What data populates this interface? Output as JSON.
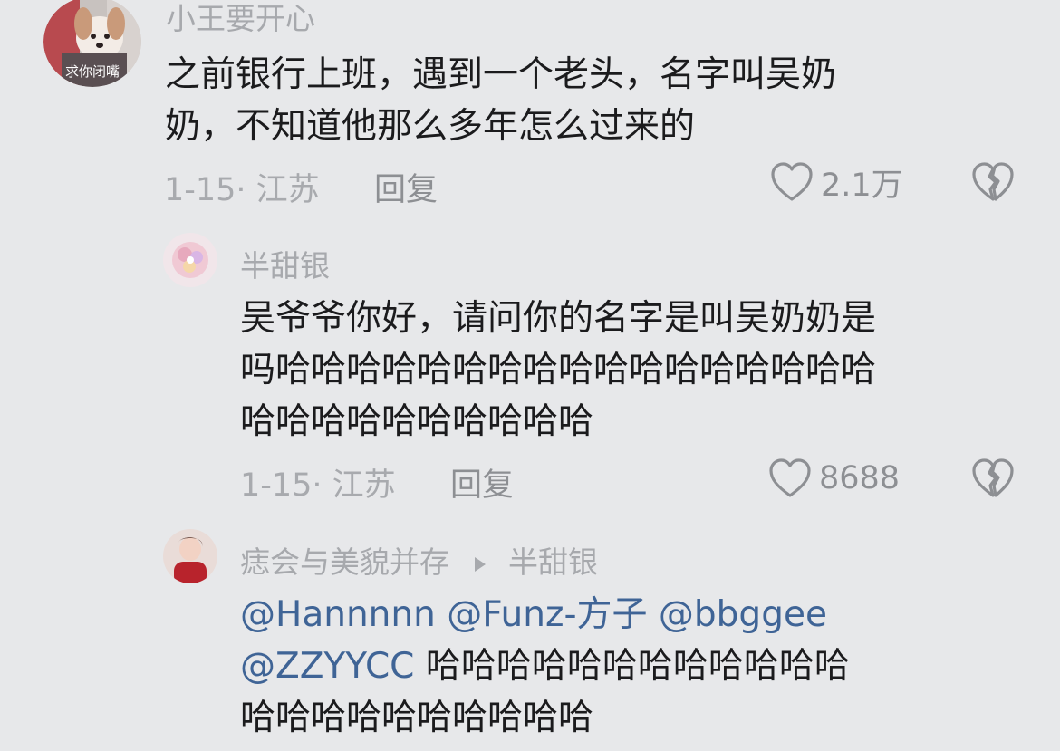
{
  "comments": [
    {
      "username": "小王要开心",
      "avatar_caption": "求你闭嘴",
      "lines": [
        "之前银行上班，遇到一个老头，名字叫吴奶",
        "奶，不知道他那么多年怎么过来的"
      ],
      "date_location": "1-15· 江苏",
      "reply_label": "回复",
      "like_count": "2.1万"
    },
    {
      "username": "半甜银",
      "lines": [
        "吴爷爷你好，请问你的名字是叫吴奶奶是",
        "吗哈哈哈哈哈哈哈哈哈哈哈哈哈哈哈哈哈",
        "哈哈哈哈哈哈哈哈哈哈"
      ],
      "date_location": "1-15· 江苏",
      "reply_label": "回复",
      "like_count": "8688"
    },
    {
      "username": "痣会与美貌并存",
      "reply_to": "半甜银",
      "mentions": [
        "@Hannnnn",
        "@Funz-方子",
        "@bbggee",
        "@ZZYYCC"
      ],
      "line2_text": "哈哈哈哈哈哈哈哈哈哈哈哈",
      "line3_text": "哈哈哈哈哈哈哈哈哈哈"
    }
  ],
  "icons": {
    "like": "heart-outline-icon",
    "dislike": "broken-heart-icon",
    "reply_arrow": "triangle-right-icon"
  },
  "colors": {
    "background": "#e7e8ea",
    "text": "#1b1b1d",
    "muted": "#a8aaae",
    "mention": "#3f6496"
  }
}
